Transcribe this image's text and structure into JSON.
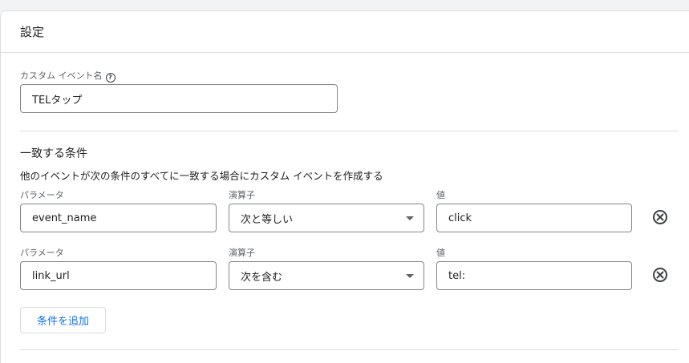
{
  "settings": {
    "title": "設定",
    "custom_event_name": {
      "label": "カスタム イベント名",
      "value": "TELタップ"
    },
    "conditions": {
      "title": "一致する条件",
      "description": "他のイベントが次の条件のすべてに一致する場合にカスタム イベントを作成する",
      "rows": [
        {
          "param_label": "パラメータ",
          "param_value": "event_name",
          "op_label": "演算子",
          "op_value": "次と等しい",
          "val_label": "値",
          "val_value": "click"
        },
        {
          "param_label": "パラメータ",
          "param_value": "link_url",
          "op_label": "演算子",
          "op_value": "次を含む",
          "val_label": "値",
          "val_value": "tel:"
        }
      ],
      "add_label": "条件を追加"
    }
  },
  "icons": {
    "help": "help-circle-icon",
    "remove": "cancel-circle-icon",
    "dropdown": "arrow-drop-down-icon"
  },
  "colors": {
    "accent": "#1a73e8",
    "border": "#dadce0",
    "field_border": "#80868b"
  }
}
